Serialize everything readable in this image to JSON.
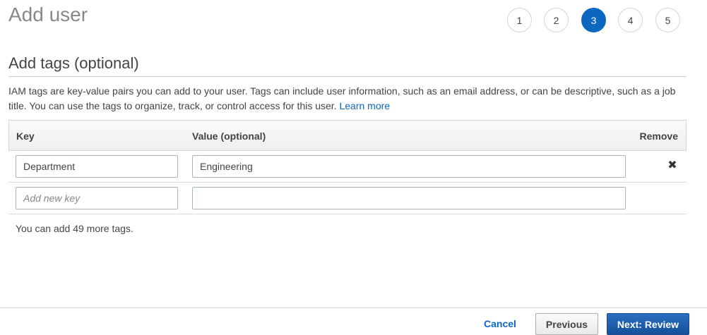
{
  "page": {
    "title": "Add user"
  },
  "steps": {
    "items": [
      "1",
      "2",
      "3",
      "4",
      "5"
    ],
    "active": "3",
    "active_color": "#0b67c0"
  },
  "section": {
    "title": "Add tags (optional)",
    "description": "IAM tags are key-value pairs you can add to your user. Tags can include user information, such as an email address, or can be descriptive, such as a job title. You can use the tags to organize, track, or control access for this user.",
    "learn_more": "Learn more"
  },
  "table": {
    "headers": {
      "key": "Key",
      "value": "Value (optional)",
      "remove": "Remove"
    },
    "rows": [
      {
        "key": "Department",
        "value": "Engineering",
        "remove_icon": "close-icon"
      }
    ],
    "new_row": {
      "key_placeholder": "Add new key",
      "value": ""
    }
  },
  "tags_remaining": "You can add 49 more tags.",
  "footer": {
    "cancel": "Cancel",
    "previous": "Previous",
    "next": "Next: Review"
  }
}
